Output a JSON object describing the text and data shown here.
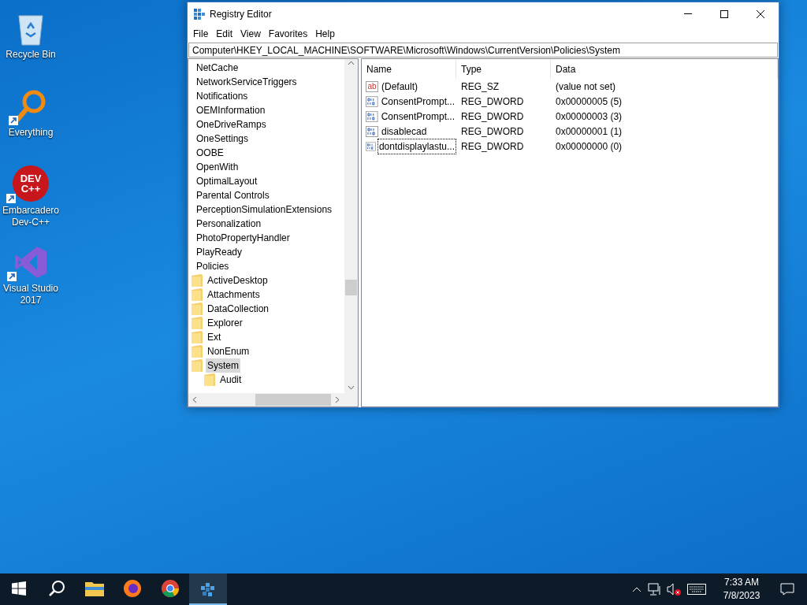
{
  "desktop_icons": [
    {
      "label": "Recycle Bin",
      "kind": "recycle",
      "shortcut": false
    },
    {
      "label": "Everything",
      "kind": "search",
      "shortcut": true
    },
    {
      "label": "Embarcadero Dev-C++",
      "kind": "devcpp",
      "shortcut": true,
      "badge": "DEV C++"
    },
    {
      "label": "Visual Studio 2017",
      "kind": "vs",
      "shortcut": true
    }
  ],
  "window": {
    "title": "Registry Editor",
    "menu": [
      "File",
      "Edit",
      "View",
      "Favorites",
      "Help"
    ],
    "address": "Computer\\HKEY_LOCAL_MACHINE\\SOFTWARE\\Microsoft\\Windows\\CurrentVersion\\Policies\\System",
    "tree": [
      {
        "label": "NetCache",
        "selected": false
      },
      {
        "label": "NetworkServiceTriggers",
        "selected": false
      },
      {
        "label": "Notifications",
        "selected": false
      },
      {
        "label": "OEMInformation",
        "selected": false
      },
      {
        "label": "OneDriveRamps",
        "selected": false
      },
      {
        "label": "OneSettings",
        "selected": false
      },
      {
        "label": "OOBE",
        "selected": false
      },
      {
        "label": "OpenWith",
        "selected": false
      },
      {
        "label": "OptimalLayout",
        "selected": false
      },
      {
        "label": "Parental Controls",
        "selected": false
      },
      {
        "label": "PerceptionSimulationExtensions",
        "selected": false
      },
      {
        "label": "Personalization",
        "selected": false
      },
      {
        "label": "PhotoPropertyHandler",
        "selected": false
      },
      {
        "label": "PlayReady",
        "selected": false
      },
      {
        "label": "Policies",
        "selected": false,
        "children": [
          {
            "label": "ActiveDesktop",
            "selected": false
          },
          {
            "label": "Attachments",
            "selected": false
          },
          {
            "label": "DataCollection",
            "selected": false
          },
          {
            "label": "Explorer",
            "selected": false
          },
          {
            "label": "Ext",
            "selected": false
          },
          {
            "label": "NonEnum",
            "selected": false
          },
          {
            "label": "System",
            "selected": true,
            "children": [
              {
                "label": "Audit",
                "selected": false
              }
            ]
          }
        ]
      }
    ],
    "columns": [
      "Name",
      "Type",
      "Data"
    ],
    "rows": [
      {
        "name": "(Default)",
        "type": "REG_SZ",
        "data": "(value not set)",
        "kind": "string",
        "icon_text": "ab",
        "focused": false
      },
      {
        "name": "ConsentPrompt...",
        "type": "REG_DWORD",
        "data": "0x00000005 (5)",
        "kind": "binary",
        "focused": false
      },
      {
        "name": "ConsentPrompt...",
        "type": "REG_DWORD",
        "data": "0x00000003 (3)",
        "kind": "binary",
        "focused": false
      },
      {
        "name": "disablecad",
        "type": "REG_DWORD",
        "data": "0x00000001 (1)",
        "kind": "binary",
        "focused": false
      },
      {
        "name": "dontdisplaylastu...",
        "type": "REG_DWORD",
        "data": "0x00000000 (0)",
        "kind": "binary",
        "focused": true
      }
    ]
  },
  "taskbar": {
    "apps": [
      {
        "kind": "start",
        "active": false
      },
      {
        "kind": "search",
        "active": false
      },
      {
        "kind": "explorer",
        "active": false
      },
      {
        "kind": "firefox",
        "active": false
      },
      {
        "kind": "chrome",
        "active": false
      },
      {
        "kind": "regedit",
        "active": true
      }
    ],
    "time": "7:33 AM",
    "date": "7/8/2023"
  }
}
